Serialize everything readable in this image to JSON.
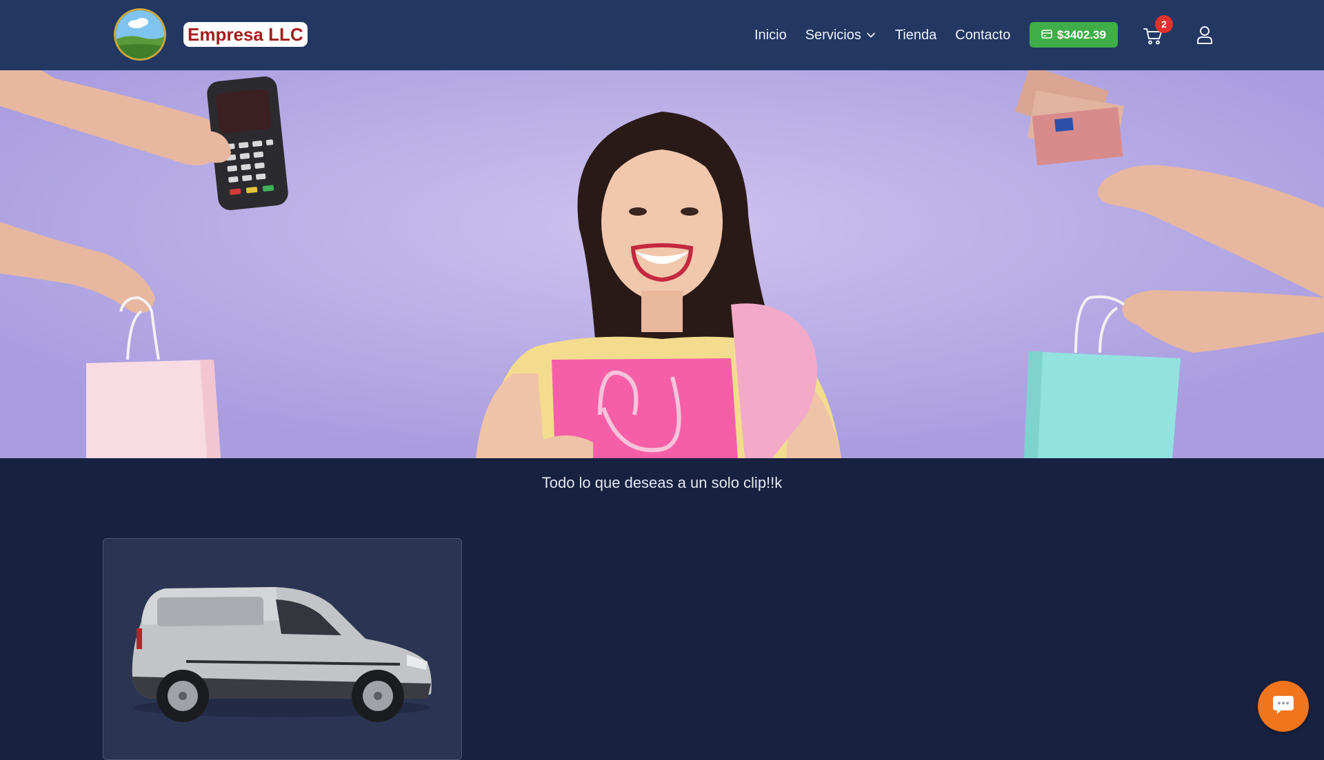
{
  "header": {
    "brand": "Empresa LLC",
    "logo_icon": "landscape-logo-icon",
    "nav": {
      "inicio": "Inicio",
      "servicios": "Servicios",
      "tienda": "Tienda",
      "contacto": "Contacto"
    },
    "balance": "$3402.39",
    "balance_icon": "credit-card-icon",
    "cart_icon": "shopping-cart-icon",
    "cart_count": "2",
    "user_icon": "user-icon"
  },
  "hero": {
    "image": "woman-with-shopping-bags-and-hands-holding-card-terminal-money-and-bags"
  },
  "tagline": "Todo lo que deseas a un solo clip!!k",
  "products": [
    {
      "image": "silver-delivery-van"
    }
  ],
  "chat": {
    "icon": "chat-bubble-icon"
  },
  "colors": {
    "header_bg": "#223761",
    "page_bg": "#172140",
    "brand_text": "#a31d1d",
    "balance_bg": "#3fae49",
    "badge_bg": "#e0322e",
    "chat_bg": "#f0751c",
    "hero_bg": "#b3a7e0"
  }
}
